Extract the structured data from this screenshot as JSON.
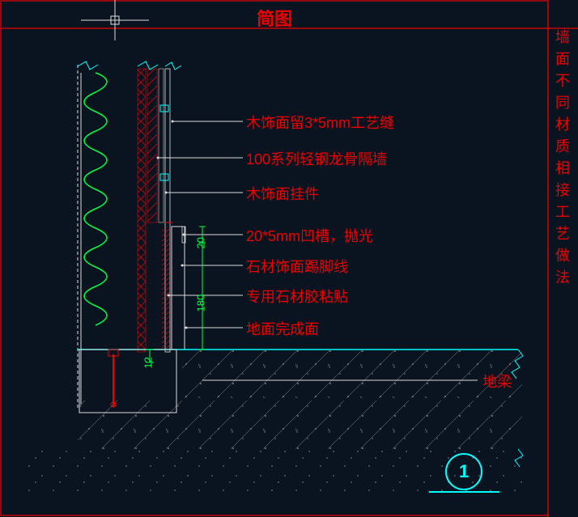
{
  "title": "简图",
  "right_label": "墙面不同材质相接工艺做法",
  "annotations": [
    {
      "text": "木饰面留3*5mm工艺缝"
    },
    {
      "text": "100系列轻钢龙骨隔墙"
    },
    {
      "text": "木饰面挂件"
    },
    {
      "text": "20*5mm凹槽，抛光"
    },
    {
      "text": "石材饰面踢脚线"
    },
    {
      "text": "专用石材胶粘贴"
    },
    {
      "text": "地面完成面"
    },
    {
      "text": "地梁"
    }
  ],
  "dims": {
    "d1": "20",
    "d2": "180",
    "d3": "12"
  },
  "detail_number": "1",
  "chart_data": {
    "type": "diagram",
    "title": "简图 — 墙面不同材质相接工艺做法",
    "description": "Construction cross-section detail: joint between wall finishes and floor at skirting, with light-gauge steel stud partition behind wood veneer panels and stone skirting above a ground beam.",
    "callouts": [
      "木饰面留3*5mm工艺缝",
      "100系列轻钢龙骨隔墙",
      "木饰面挂件",
      "20*5mm凹槽，抛光",
      "石材饰面踢脚线",
      "专用石材胶粘贴",
      "地面完成面",
      "地梁"
    ],
    "dimensions_mm": {
      "groove_height": 20,
      "skirting_height": 180,
      "ffl_to_beam_gap": 12,
      "process_gap": "3*5",
      "groove": "20*5"
    },
    "detail_tag": "1"
  }
}
